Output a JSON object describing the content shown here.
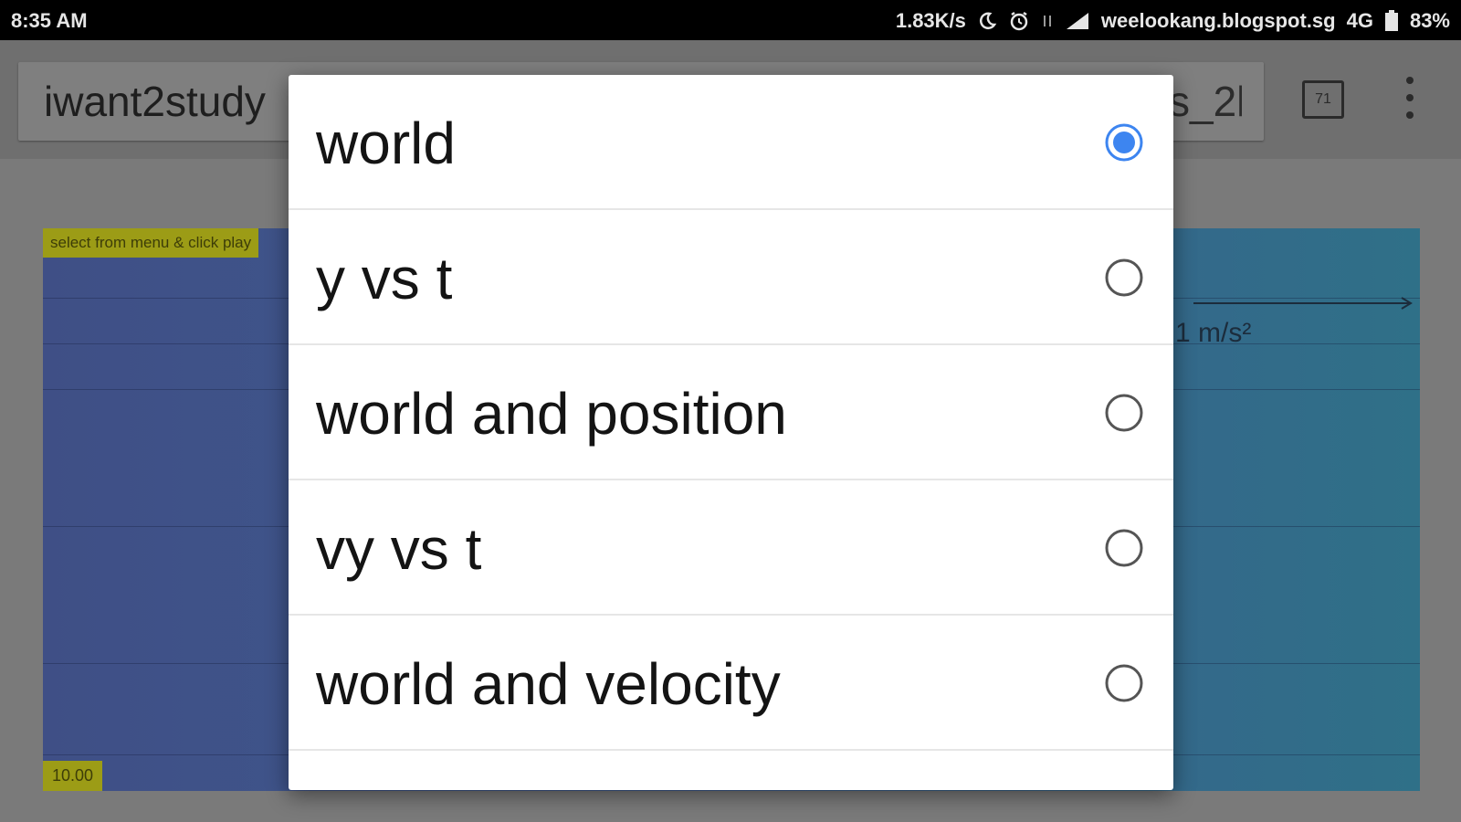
{
  "status_bar": {
    "time": "8:35 AM",
    "speed": "1.83K/s",
    "carrier": "weelookang.blogspot.sg",
    "network": "4G",
    "battery": "83%"
  },
  "browser": {
    "url": "iwant2study",
    "url_tail": "s_2l",
    "tab_count": "71"
  },
  "simulation": {
    "hint": "select from menu & click play",
    "readout": "10.00",
    "acceleration_label": "1 m/s²"
  },
  "dialog": {
    "options": [
      {
        "label": "world",
        "selected": true
      },
      {
        "label": "y vs t",
        "selected": false
      },
      {
        "label": "world and position",
        "selected": false
      },
      {
        "label": "vy vs t",
        "selected": false
      },
      {
        "label": "world and velocity",
        "selected": false
      }
    ],
    "accent_color": "#3d85f0"
  }
}
